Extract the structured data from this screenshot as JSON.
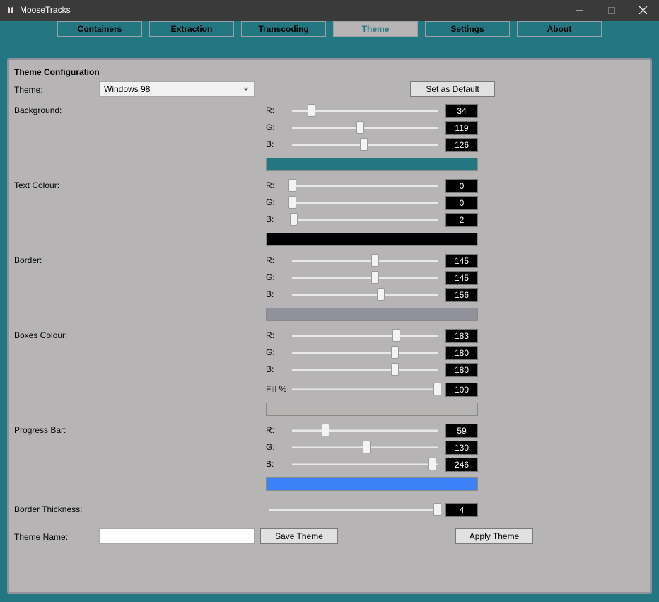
{
  "window": {
    "title": "MooseTracks"
  },
  "tabs": [
    {
      "label": "Containers",
      "active": false
    },
    {
      "label": "Extraction",
      "active": false
    },
    {
      "label": "Transcoding",
      "active": false
    },
    {
      "label": "Theme",
      "active": true
    },
    {
      "label": "Settings",
      "active": false
    },
    {
      "label": "About",
      "active": false
    }
  ],
  "theme_config": {
    "heading": "Theme Configuration",
    "theme_label": "Theme:",
    "theme_value": "Windows 98",
    "set_default_label": "Set as Default",
    "sections": {
      "background": {
        "label": "Background:",
        "r_label": "R:",
        "g_label": "G:",
        "b_label": "B:",
        "r": "34",
        "g": "119",
        "b": "126",
        "swatch_color": "#227780"
      },
      "text_colour": {
        "label": "Text Colour:",
        "r_label": "R:",
        "g_label": "G:",
        "b_label": "B:",
        "r": "0",
        "g": "0",
        "b": "2",
        "swatch_color": "#000002"
      },
      "border": {
        "label": "Border:",
        "r_label": "R:",
        "g_label": "G:",
        "b_label": "B:",
        "r": "145",
        "g": "145",
        "b": "156",
        "swatch_color": "#91919c"
      },
      "boxes_colour": {
        "label": "Boxes Colour:",
        "r_label": "R:",
        "g_label": "G:",
        "b_label": "B:",
        "fill_label": "Fill %",
        "r": "183",
        "g": "180",
        "b": "180",
        "fill": "100",
        "swatch_color": "#b7b4b4"
      },
      "progress_bar": {
        "label": "Progress Bar:",
        "r_label": "R:",
        "g_label": "G:",
        "b_label": "B:",
        "r": "59",
        "g": "130",
        "b": "246",
        "swatch_color": "#3b82f6"
      }
    },
    "border_thickness_label": "Border Thickness:",
    "border_thickness": "4",
    "theme_name_label": "Theme Name:",
    "theme_name_value": "",
    "save_theme_label": "Save Theme",
    "apply_theme_label": "Apply Theme"
  }
}
